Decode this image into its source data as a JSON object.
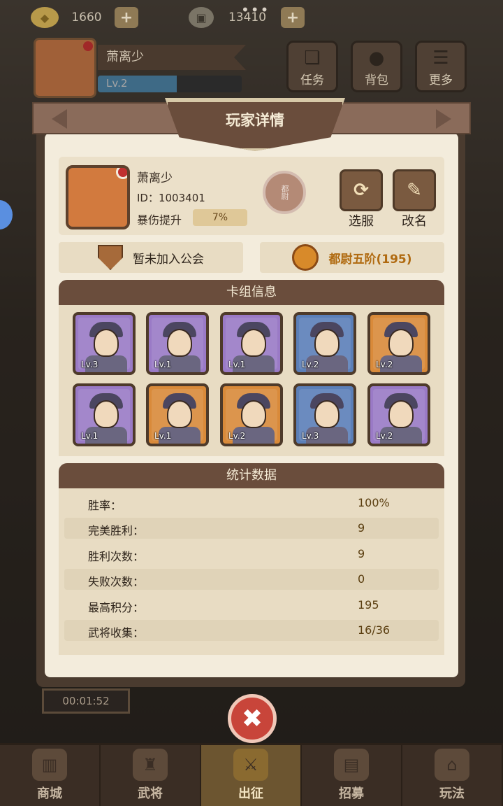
{
  "currency": {
    "gold": "1660",
    "coin": "13410",
    "plus": "+",
    "gold_icon": "gold-ingot-icon",
    "coin_icon": "copper-coin-icon"
  },
  "menu_dots": "•••",
  "player_header": {
    "name": "萧离少",
    "level": "Lv.2",
    "level_progress": 0.55
  },
  "top_buttons": [
    {
      "label": "任务",
      "icon": "scroll-icon"
    },
    {
      "label": "背包",
      "icon": "bag-icon"
    },
    {
      "label": "更多",
      "icon": "list-icon"
    }
  ],
  "modal": {
    "title": "玩家详情",
    "profile": {
      "name": "萧离少",
      "id": "ID：1003401",
      "crit_label": "暴伤提升",
      "crit_value": "7%",
      "rank_badge": "都尉"
    },
    "actions": [
      {
        "label": "选服",
        "icon": "refresh-icon",
        "glyph": "⟳"
      },
      {
        "label": "改名",
        "icon": "pencil-icon",
        "glyph": "✎"
      }
    ],
    "guild": "暂未加入公会",
    "rank": "都尉五阶(195)",
    "deck": {
      "title": "卡组信息",
      "cards": [
        {
          "level": "Lv.3",
          "rarity": "purple"
        },
        {
          "level": "Lv.1",
          "rarity": "purple"
        },
        {
          "level": "Lv.1",
          "rarity": "purple"
        },
        {
          "level": "Lv.2",
          "rarity": "blue"
        },
        {
          "level": "Lv.2",
          "rarity": "orange"
        },
        {
          "level": "Lv.1",
          "rarity": "purple"
        },
        {
          "level": "Lv.1",
          "rarity": "orange"
        },
        {
          "level": "Lv.2",
          "rarity": "orange"
        },
        {
          "level": "Lv.3",
          "rarity": "blue"
        },
        {
          "level": "Lv.2",
          "rarity": "purple"
        }
      ]
    },
    "stats": {
      "title": "统计数据",
      "rows": [
        {
          "label": "胜率：",
          "value": "100%"
        },
        {
          "label": "完美胜利：",
          "value": "9"
        },
        {
          "label": "胜利次数：",
          "value": "9"
        },
        {
          "label": "失败次数：",
          "value": "0"
        },
        {
          "label": "最高积分：",
          "value": "195"
        },
        {
          "label": "武将收集：",
          "value": "16/36"
        }
      ]
    },
    "close": "✖"
  },
  "timer": "00:01:52",
  "bottom_nav": [
    {
      "label": "商城",
      "icon": "shop-icon",
      "active": false
    },
    {
      "label": "武将",
      "icon": "general-icon",
      "active": false
    },
    {
      "label": "出征",
      "icon": "battle-icon",
      "active": true
    },
    {
      "label": "招募",
      "icon": "recruit-icon",
      "active": false
    },
    {
      "label": "玩法",
      "icon": "pagoda-icon",
      "active": false
    }
  ]
}
